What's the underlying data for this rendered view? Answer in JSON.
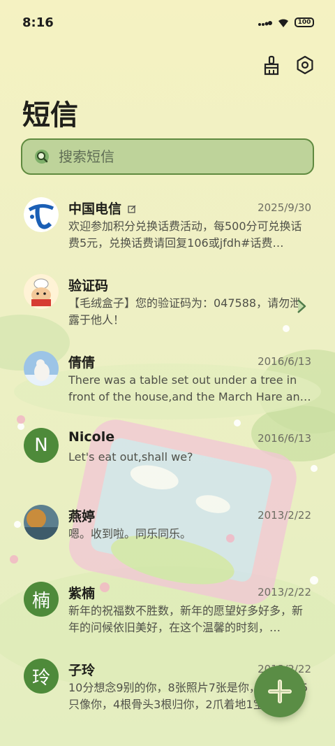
{
  "status": {
    "time": "8:16",
    "battery": "100"
  },
  "header": {
    "title": "短信"
  },
  "search": {
    "placeholder": "搜索短信"
  },
  "messages": [
    {
      "name": "中国电信",
      "date": "2025/9/30",
      "preview": "欢迎参加积分兑换话费活动，每500分可兑换话费5元，兑换话费请回复106或jfdh#话费…",
      "avatar": "telecom-logo"
    },
    {
      "name": "验证码",
      "date": "",
      "preview": "【毛绒盒子】您的验证码为：047588，请勿泄露于他人！",
      "avatar": "cartoon"
    },
    {
      "name": "倩倩",
      "date": "2016/6/13",
      "preview": "There was a table set out under a tree in front of the house,and the March Hare an…",
      "avatar": "polar-bear"
    },
    {
      "name": "Nicole",
      "date": "2016/6/13",
      "preview": "Let's eat out,shall we?",
      "avatar": "N"
    },
    {
      "name": "燕婷",
      "date": "2013/2/22",
      "preview": "嗯。收到啦。同乐同乐。",
      "avatar": "photo"
    },
    {
      "name": "紫楠",
      "date": "2013/2/22",
      "preview": "新年的祝福数不胜数，新年的愿望好多好多，新年的问候依旧美好，在这个温馨的时刻，…",
      "avatar": "楠"
    },
    {
      "name": "子玲",
      "date": "2013/2/22",
      "preview": "10分想念9别的你，8张照片7张是你，6只小狗5只像你，4根骨头3根归你，2爪着地1宝…",
      "avatar": "玲"
    }
  ],
  "colors": {
    "accent": "#5a8d45",
    "search_bg": "#bed39a",
    "background": "#f4f1c0"
  }
}
